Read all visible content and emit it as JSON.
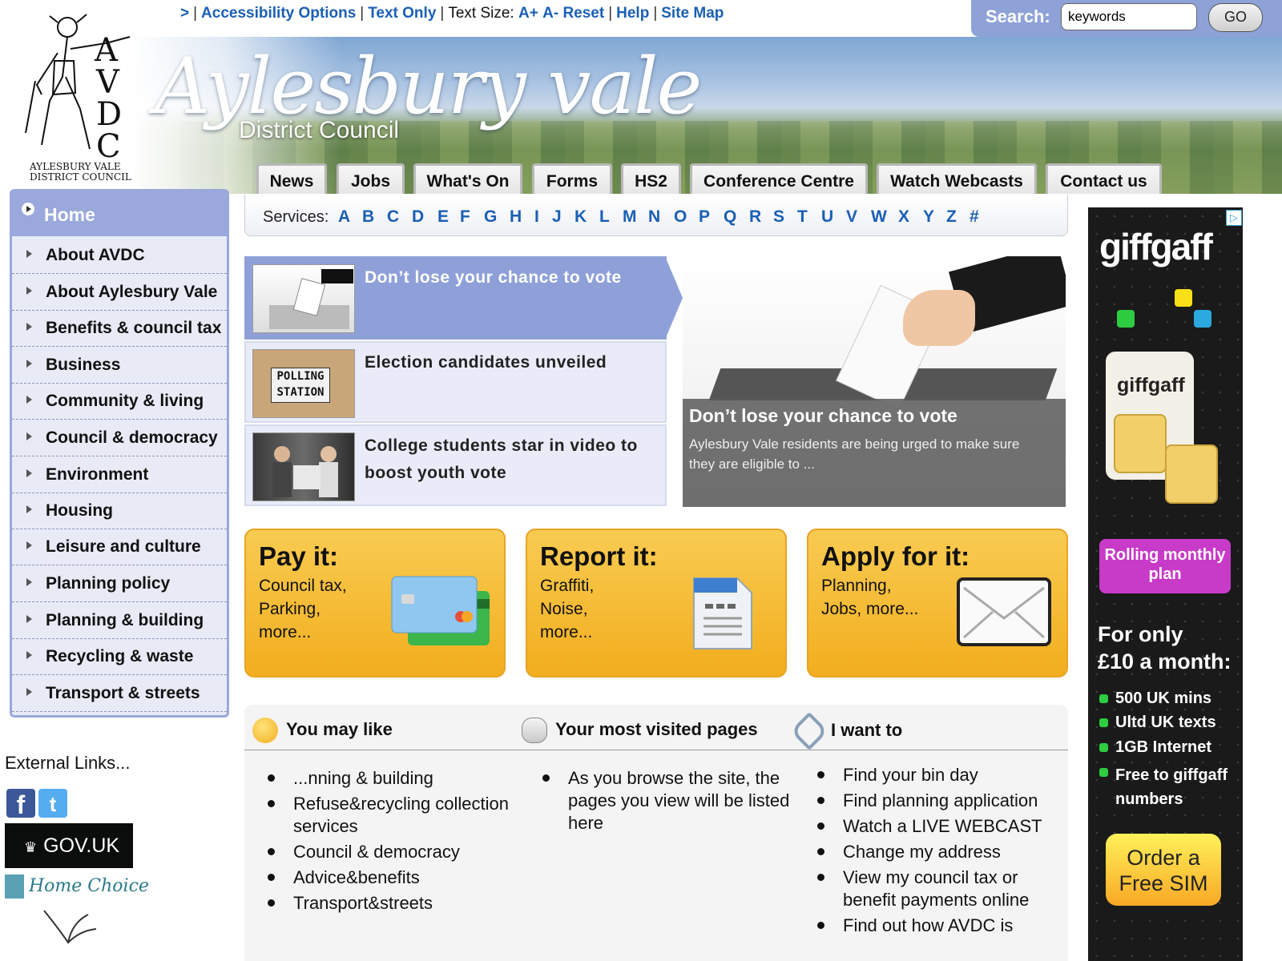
{
  "utility": {
    "prefix": ">",
    "links": [
      "Accessibility Options",
      "Text Only"
    ],
    "text_size_label": "Text Size:",
    "text_size_links": [
      "A+",
      "A-",
      "Reset"
    ],
    "help": "Help",
    "site_map": "Site Map"
  },
  "search": {
    "label": "Search:",
    "value": "keywords",
    "button": "GO"
  },
  "logo": {
    "letters": [
      "A",
      "V",
      "D",
      "C"
    ],
    "line1": "AYLESBURY VALE",
    "line2": "DISTRICT COUNCIL"
  },
  "banner": {
    "title": "Aylesbury vale",
    "subtitle": "District Council"
  },
  "nav": [
    "News",
    "Jobs",
    "What's On",
    "Forms",
    "HS2",
    "Conference Centre",
    "Watch Webcasts",
    "Contact us"
  ],
  "sidebar": {
    "home": "Home",
    "items": [
      "About AVDC",
      "About Aylesbury Vale",
      "Benefits & council tax",
      "Business",
      "Community & living",
      "Council & democracy",
      "Environment",
      "Housing",
      "Leisure and culture",
      "Planning policy",
      "Planning & building",
      "Recycling & waste",
      "Transport & streets"
    ]
  },
  "external": {
    "title": "External Links...",
    "facebook": "f",
    "twitter": "t",
    "govuk": "GOV.UK",
    "homechoice": "Home Choice"
  },
  "services": {
    "label": "Services:",
    "letters": [
      "A",
      "B",
      "C",
      "D",
      "E",
      "F",
      "G",
      "H",
      "I",
      "J",
      "K",
      "L",
      "M",
      "N",
      "O",
      "P",
      "Q",
      "R",
      "S",
      "T",
      "U",
      "V",
      "W",
      "X",
      "Y",
      "Z",
      "#"
    ]
  },
  "news": [
    {
      "headline": "Don’t lose your chance to vote",
      "thumb_text": ""
    },
    {
      "headline": "Election candidates unveiled",
      "thumb_text": "POLLING STATION"
    },
    {
      "headline": "College students star in video to boost youth vote",
      "thumb_text": ""
    }
  ],
  "feature": {
    "title": "Don’t lose your chance to vote",
    "description": "Aylesbury Vale residents are being urged to make sure they are eligible to ..."
  },
  "actions": [
    {
      "title": "Pay it:",
      "lines": [
        "Council tax,",
        "Parking,",
        "more..."
      ],
      "icon": "credit-card-icon"
    },
    {
      "title": "Report it:",
      "lines": [
        "Graffiti,",
        "Noise,",
        "more..."
      ],
      "icon": "document-icon"
    },
    {
      "title": "Apply for it:",
      "lines": [
        "Planning,",
        "Jobs, more..."
      ],
      "icon": "envelope-icon"
    }
  ],
  "bottom": {
    "may_like": {
      "title": "You may like",
      "items": [
        "...nning & building",
        "Refuse&recycling collection services",
        "Council & democracy",
        "Advice&benefits",
        "Transport&streets"
      ]
    },
    "most_visited": {
      "title": "Your most visited pages",
      "items": [
        "As you browse the site, the pages you view will be listed here"
      ]
    },
    "i_want_to": {
      "title": "I want to",
      "items": [
        "Find your bin day",
        "Find planning application",
        "Watch a LIVE WEBCAST",
        "Change my address",
        "View my council tax or benefit payments online",
        "Find out how AVDC is"
      ]
    }
  },
  "ad": {
    "brand": "giffgaff",
    "sim_brand": "giffgaff",
    "bubble": "Rolling monthly plan",
    "price_line1": "For only",
    "price_line2": "£10 a month:",
    "features": [
      "500 UK mins",
      "Ultd UK texts",
      "1GB Internet",
      "Free to giffgaff numbers"
    ],
    "cta": "Order a Free SIM"
  },
  "colors": {
    "link": "#1a5fb4",
    "sidebar_accent": "#9aa8db",
    "action_orange": "#f2ae1e",
    "news_highlight": "#8fa0d9"
  }
}
